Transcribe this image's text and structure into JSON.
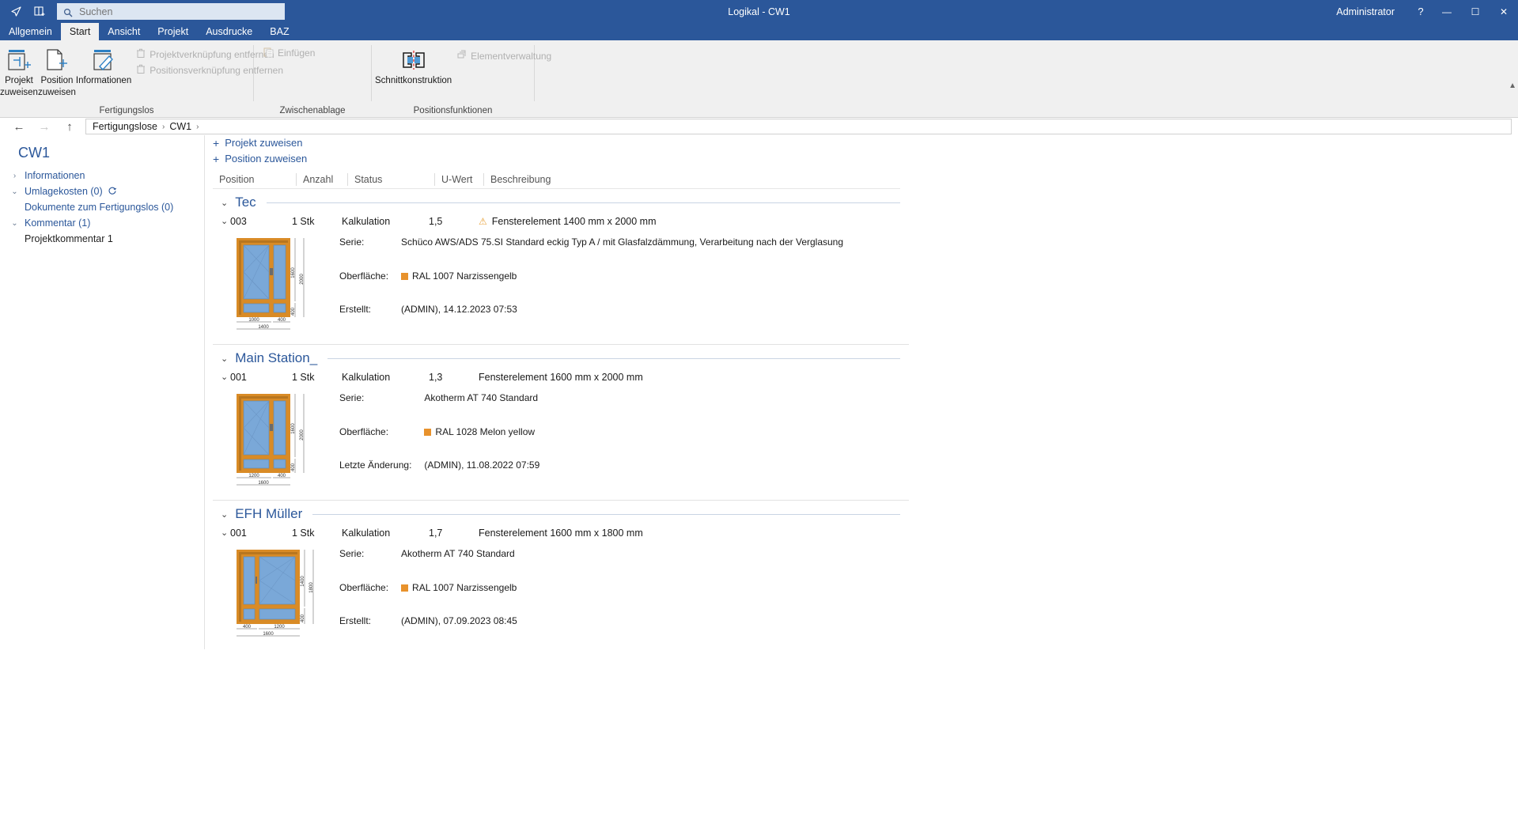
{
  "titlebar": {
    "window_title": "Logikal - CW1",
    "user": "Administrator",
    "help_label": "?",
    "minimize_label": "—",
    "maximize_label": "☐",
    "close_label": "✕",
    "icon_nav": "cursor-arrow-icon",
    "icon_newwin": "new-window-icon"
  },
  "search": {
    "placeholder": "Suchen",
    "value": ""
  },
  "menu_tabs": [
    {
      "label": "Allgemein",
      "active": false
    },
    {
      "label": "Start",
      "active": true
    },
    {
      "label": "Ansicht",
      "active": false
    },
    {
      "label": "Projekt",
      "active": false
    },
    {
      "label": "Ausdrucke",
      "active": false
    },
    {
      "label": "BAZ",
      "active": false
    }
  ],
  "ribbon": {
    "groups": [
      {
        "label": "Fertigungslos"
      },
      {
        "label": "Zwischenablage"
      },
      {
        "label": "Positionsfunktionen"
      }
    ],
    "buttons": {
      "projekt_zuweisen_l1": "Projekt",
      "projekt_zuweisen_l2": "zuweisen",
      "position_zuweisen_l1": "Position",
      "position_zuweisen_l2": "zuweisen",
      "informationen": "Informationen",
      "projektverknuepfung_entfernen": "Projektverknüpfung entfernen",
      "positionsverknuepfung_entfernen": "Positionsverknüpfung entfernen",
      "einfuegen": "Einfügen",
      "schnittkonstruktion": "Schnittkonstruktion",
      "elementverwaltung": "Elementverwaltung"
    }
  },
  "nav": {
    "back": "←",
    "forward": "→",
    "up": "↑",
    "breadcrumbs": [
      "Fertigungslose",
      "CW1"
    ],
    "separator": "›"
  },
  "sidebar": {
    "title": "CW1",
    "items": [
      {
        "label": "Informationen",
        "chev": "›",
        "type": "node"
      },
      {
        "label": "Umlagekosten (0)",
        "chev": "⌄",
        "type": "node",
        "refresh": true
      },
      {
        "label": "Dokumente zum Fertigungslos (0)",
        "type": "sub"
      },
      {
        "label": "Kommentar (1)",
        "chev": "⌄",
        "type": "node"
      },
      {
        "label": "Projektkommentar 1",
        "type": "plain"
      }
    ]
  },
  "content": {
    "add_links": [
      {
        "label": "Projekt zuweisen",
        "plus": "+"
      },
      {
        "label": "Position zuweisen",
        "plus": "+"
      }
    ],
    "columns": [
      "Position",
      "Anzahl",
      "Status",
      "U-Wert",
      "Beschreibung"
    ],
    "groups": [
      {
        "name": "Tec",
        "chev": "⌄",
        "rows": [
          {
            "position": "003",
            "anzahl": "1 Stk",
            "status": "Kalkulation",
            "uwert": "1,5",
            "warning": true,
            "beschreibung": "Fensterelement 1400 mm x 2000 mm",
            "details": [
              {
                "key": "Serie:",
                "value": "Schüco AWS/ADS 75.SI Standard eckig Typ A / mit Glasfalzdämmung, Verarbeitung nach der Verglasung"
              },
              {
                "key": "Oberfläche:",
                "value": "RAL 1007 Narzissengelb",
                "swatch": "#e8922c"
              },
              {
                "key": "Erstellt:",
                "value": "(ADMIN), 14.12.2023 07:53"
              }
            ],
            "drawing": {
              "type": "three-pane-window",
              "dim_left_top": "1600",
              "dim_left_bottom": "400",
              "dim_right": "2000",
              "dim_bottom_left": "1000",
              "dim_bottom_right": "400",
              "dim_total": "1400",
              "layout": "left-wide"
            }
          }
        ]
      },
      {
        "name": "Main Station_",
        "chev": "⌄",
        "rows": [
          {
            "position": "001",
            "anzahl": "1 Stk",
            "status": "Kalkulation",
            "uwert": "1,3",
            "warning": false,
            "beschreibung": "Fensterelement 1600 mm x 2000 mm",
            "details": [
              {
                "key": "Serie:",
                "value": "Akotherm AT 740 Standard"
              },
              {
                "key": "Oberfläche:",
                "value": "RAL 1028 Melon yellow",
                "swatch": "#e8922c"
              },
              {
                "key": "Letzte Änderung:",
                "value": "(ADMIN), 11.08.2022 07:59"
              }
            ],
            "drawing": {
              "type": "three-pane-window",
              "dim_left_top": "1600",
              "dim_left_bottom": "400",
              "dim_right": "2000",
              "dim_bottom_left": "1200",
              "dim_bottom_right": "400",
              "dim_total": "1600",
              "layout": "left-wide"
            }
          }
        ]
      },
      {
        "name": "EFH Müller",
        "chev": "⌄",
        "rows": [
          {
            "position": "001",
            "anzahl": "1 Stk",
            "status": "Kalkulation",
            "uwert": "1,7",
            "warning": false,
            "beschreibung": "Fensterelement 1600 mm x 1800 mm",
            "details": [
              {
                "key": "Serie:",
                "value": "Akotherm AT 740 Standard"
              },
              {
                "key": "Oberfläche:",
                "value": "RAL 1007 Narzissengelb",
                "swatch": "#e8922c"
              },
              {
                "key": "Erstellt:",
                "value": "(ADMIN), 07.09.2023 08:45"
              }
            ],
            "drawing": {
              "type": "three-pane-window",
              "dim_left_top": "1400",
              "dim_left_bottom": "400",
              "dim_right": "1800",
              "dim_bottom_left": "400",
              "dim_bottom_right": "1200",
              "dim_total": "1600",
              "layout": "right-wide"
            }
          }
        ]
      }
    ]
  },
  "colors": {
    "brand_blue": "#2b579a",
    "link_blue": "#2b579a",
    "frame_orange": "#d98b26",
    "glass_blue": "#7aa8d8",
    "warning_amber": "#e8a33d"
  }
}
